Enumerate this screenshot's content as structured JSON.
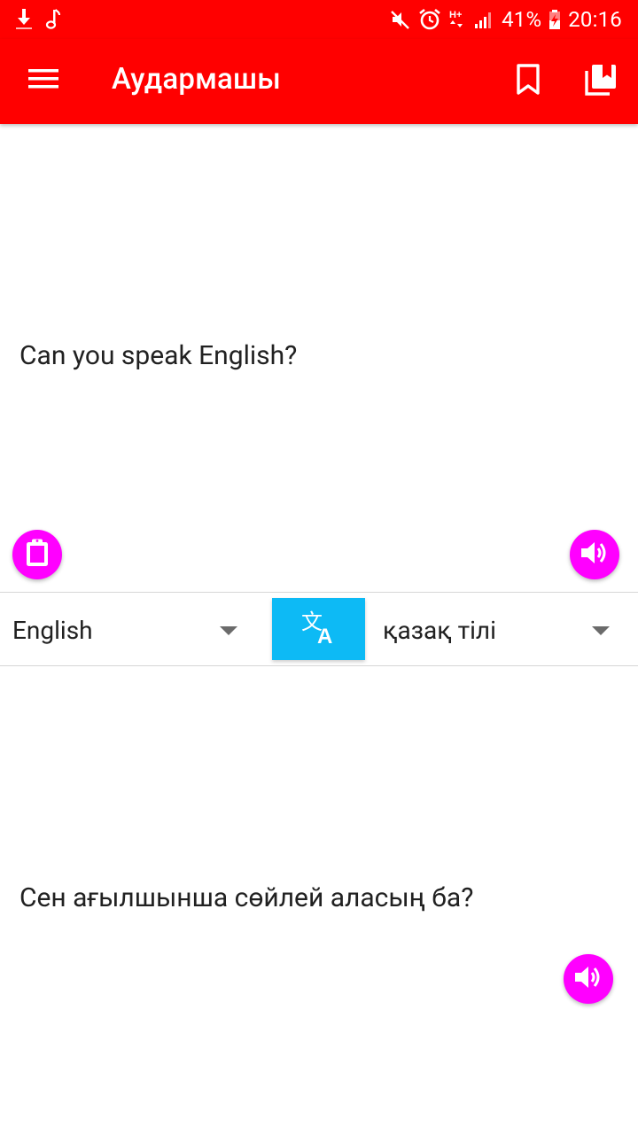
{
  "status_bar": {
    "battery": "41%",
    "time": "20:16",
    "icons": [
      "download-icon",
      "music-note-icon",
      "mute-icon",
      "alarm-icon",
      "data-h-plus-icon",
      "signal-icon",
      "battery-icon"
    ]
  },
  "app_bar": {
    "title": "Аудармашы",
    "icons": [
      "menu-icon",
      "bookmark-icon",
      "library-icon"
    ]
  },
  "source": {
    "text": "Can you speak English?"
  },
  "language_bar": {
    "source_language": "English",
    "target_language": "қазақ тілі",
    "translate_icon": "translate-icon"
  },
  "target": {
    "text": "Сен ағылшынша сөйлей аласың ба?"
  },
  "colors": {
    "app_bar": "#ff0000",
    "fab": "#ff00ff",
    "translate_button": "#0dbaf5"
  }
}
